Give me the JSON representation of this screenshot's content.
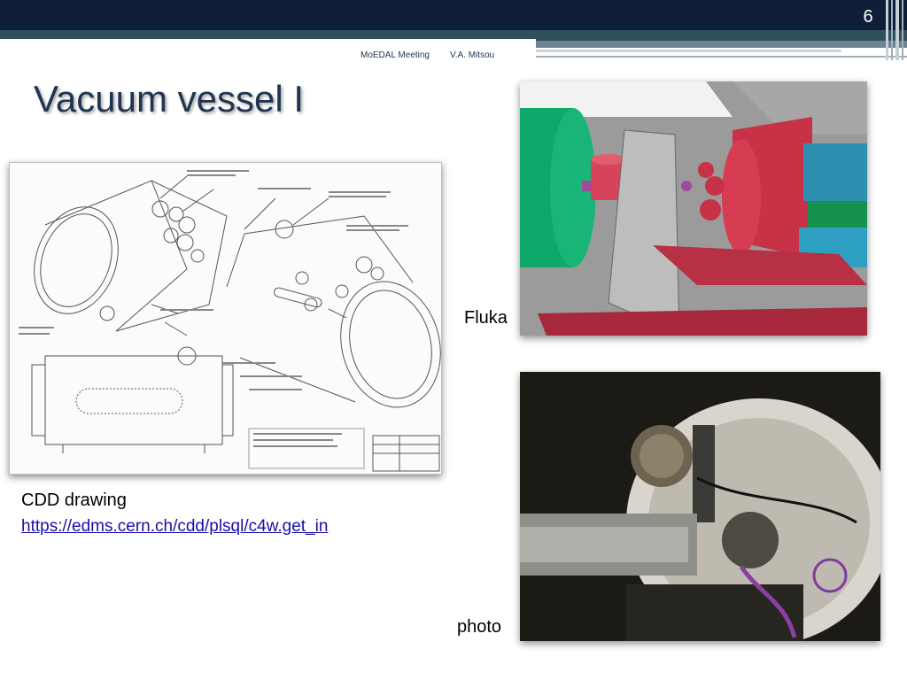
{
  "slide": {
    "number": "6",
    "footer_meeting": "MoEDAL Meeting",
    "footer_author": "V.A. Mitsou",
    "title": "Vacuum vessel I"
  },
  "images": {
    "drawing_alt": "CDD technical drawing of the vacuum vessel",
    "fluka_alt": "Fluka geometry rendering",
    "photo_alt": "photo of the vacuum vessel"
  },
  "captions": {
    "fluka": "Fluka",
    "photo": "photo",
    "cdd": "CDD drawing",
    "cdd_link": "https://edms.cern.ch/cdd/plsql/c4w.get_in"
  },
  "colors": {
    "header_dark": "#0f1f3a",
    "header_teal": "#2f4f5f",
    "title": "#1f3550",
    "link": "#1a0dab"
  }
}
